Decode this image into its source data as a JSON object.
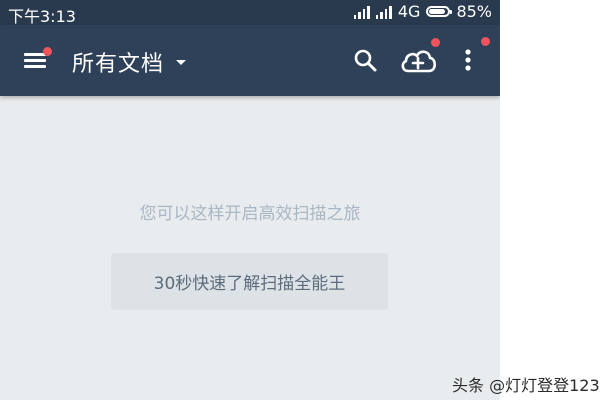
{
  "status_bar": {
    "time": "下午3:13",
    "network": "4G",
    "battery_percent": "85%",
    "battery_level": 0.85
  },
  "app_bar": {
    "title": "所有文档",
    "background_color": "#2f4159",
    "menu_icon": "hamburger-menu-icon",
    "dropdown_icon": "caret-down-icon",
    "search_icon": "search-icon",
    "cloud_icon": "cloud-add-icon",
    "more_icon": "more-vertical-icon",
    "notification_dot_color": "#f2545b"
  },
  "content": {
    "hint_text": "您可以这样开启高效扫描之旅",
    "tour_button_label": "30秒快速了解扫描全能王",
    "background_color": "#e9ecee"
  },
  "watermark": {
    "text": "头条 @灯灯登登123"
  }
}
